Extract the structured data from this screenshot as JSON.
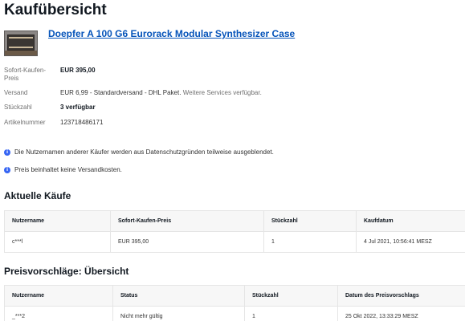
{
  "page": {
    "title": "Kaufübersicht"
  },
  "item": {
    "image_alt": "Doepfer A 100 G6 case photo",
    "title": "Doepfer A 100 G6 Eurorack Modular Synthesizer Case"
  },
  "details": [
    {
      "label": "Sofort-Kaufen-Preis",
      "value": "EUR 395,00",
      "bold": true,
      "extra": ""
    },
    {
      "label": "Versand",
      "value": "EUR 6,99 - Standardversand - DHL Paket.",
      "bold": false,
      "extra": "Weitere Services verfügbar."
    },
    {
      "label": "Stückzahl",
      "value": "3 verfügbar",
      "bold": true,
      "extra": ""
    },
    {
      "label": "Artikelnummer",
      "value": "123718486171",
      "bold": false,
      "extra": ""
    }
  ],
  "notices": [
    "Die Nutzernamen anderer Käufer werden aus Datenschutzgründen teilweise ausgeblendet.",
    "Preis beinhaltet keine Versandkosten."
  ],
  "purchases": {
    "title": "Aktuelle Käufe",
    "columns": [
      "Nutzername",
      "Sofort-Kaufen-Preis",
      "Stückzahl",
      "Kaufdatum"
    ],
    "rows": [
      [
        "c***l",
        "EUR 395,00",
        "1",
        "4 Jul 2021, 10:56:41 MESZ"
      ]
    ]
  },
  "offers": {
    "title": "Preisvorschläge: Übersicht",
    "columns": [
      "Nutzername",
      "Status",
      "Stückzahl",
      "Datum des Preisvorschlags"
    ],
    "rows": [
      [
        "_***2",
        "Nicht mehr gültig",
        "1",
        "25 Okt 2022, 13:33:29 MESZ"
      ]
    ]
  },
  "colors": {
    "link": "#0654ba",
    "info_icon": "#3665f3"
  },
  "icons": {
    "info": "info-icon"
  }
}
